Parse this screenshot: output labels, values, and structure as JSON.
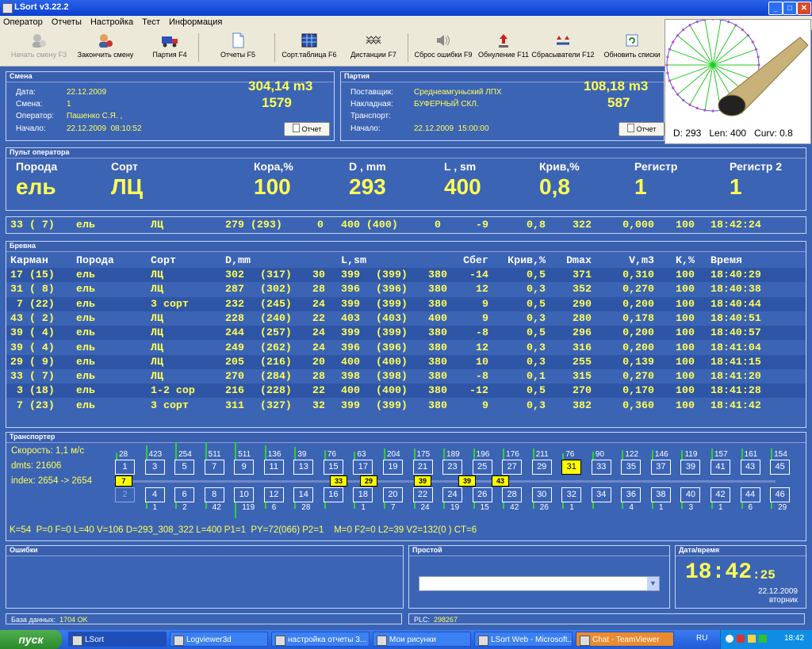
{
  "window": {
    "title": "LSort v3.22.2",
    "btn_min": "_",
    "btn_max": "□",
    "btn_close": "✕"
  },
  "menu": [
    "Оператор",
    "Отчеты",
    "Настройка",
    "Тест",
    "Информация"
  ],
  "toolbar": [
    {
      "label": "Начать смену F3",
      "disabled": true,
      "icon": "start-shift-icon"
    },
    {
      "label": "Закончить смену",
      "disabled": false,
      "icon": "end-shift-icon"
    },
    {
      "label": "Партия F4",
      "disabled": false,
      "icon": "truck-icon"
    },
    {
      "label": "Отчеты F5",
      "disabled": false,
      "icon": "document-icon"
    },
    {
      "label": "Сорт.таблица F6",
      "disabled": false,
      "icon": "table-icon"
    },
    {
      "label": "Дистанции F7",
      "disabled": false,
      "icon": "distance-icon"
    },
    {
      "label": "Сброс ошибки F9",
      "disabled": false,
      "icon": "speaker-icon"
    },
    {
      "label": "Обнуление F11",
      "disabled": false,
      "icon": "reset-arrow-icon"
    },
    {
      "label": "Сбрасыватели F12",
      "disabled": false,
      "icon": "ejector-icon"
    },
    {
      "label": "Обновить списки",
      "disabled": false,
      "icon": "refresh-icon"
    }
  ],
  "view3d": {
    "caption": "D: 293   Len: 400   Curv: 0.8"
  },
  "shift": {
    "title": "Смена",
    "date_label": "Дата:",
    "date": "22.12.2009",
    "shift_label": "Смена:",
    "shift": "1",
    "operator_label": "Оператор:",
    "operator": "Пашенко С.Я. ,",
    "start_label": "Начало:",
    "start": "22.12.2009  08:10:52",
    "volume": "304,14 m3",
    "count": "1579",
    "report_button": "Отчет"
  },
  "batch": {
    "title": "Партия",
    "supplier_label": "Поставщик:",
    "supplier": "Среднеамгуньский ЛПХ",
    "invoice_label": "Накладная:",
    "invoice": "БУФЕРНЫЙ СКЛ.",
    "transport_label": "Транспорт:",
    "transport": "",
    "start_label": "Начало:",
    "start": "22.12.2009  15:00:00",
    "volume": "108,18 m3",
    "count": "587",
    "report_button": "Отчет"
  },
  "operator_panel": {
    "title": "Пульт оператора",
    "fields": [
      {
        "label": "Порода",
        "value": "ель"
      },
      {
        "label": "Сорт",
        "value": "ЛЦ"
      },
      {
        "label": "Кора,%",
        "value": "100"
      },
      {
        "label": "D , mm",
        "value": "293"
      },
      {
        "label": "L , sm",
        "value": "400"
      },
      {
        "label": "Крив,%",
        "value": "0,8"
      },
      {
        "label": "Регистр",
        "value": "1"
      },
      {
        "label": "Регистр 2",
        "value": "1"
      }
    ]
  },
  "current_row": [
    "33 ( 7)",
    "ель",
    "ЛЦ",
    "279 (293)",
    "0",
    "400 (400)",
    "0",
    "-9",
    "0,8",
    "322",
    "0,000",
    "100",
    "18:42:24"
  ],
  "logs": {
    "title": "Бревна",
    "headers": [
      "Карман",
      "Порода",
      "Сорт",
      "D,mm",
      "",
      "",
      "L,sm",
      "",
      "",
      "Сбег",
      "Крив,%",
      "Dmax",
      "V,m3",
      "K,%",
      "Время"
    ],
    "rows": [
      [
        "17 (15)",
        "ель",
        "ЛЦ",
        "302",
        "(317)",
        "30",
        "399",
        "(399)",
        "380",
        "-14",
        "0,5",
        "371",
        "0,310",
        "100",
        "18:40:29"
      ],
      [
        "31 ( 8)",
        "ель",
        "ЛЦ",
        "287",
        "(302)",
        "28",
        "396",
        "(396)",
        "380",
        "12",
        "0,3",
        "352",
        "0,270",
        "100",
        "18:40:38"
      ],
      [
        " 7 (22)",
        "ель",
        "3 сорт",
        "232",
        "(245)",
        "24",
        "399",
        "(399)",
        "380",
        "9",
        "0,5",
        "290",
        "0,200",
        "100",
        "18:40:44"
      ],
      [
        "43 ( 2)",
        "ель",
        "ЛЦ",
        "228",
        "(240)",
        "22",
        "403",
        "(403)",
        "400",
        "9",
        "0,3",
        "280",
        "0,178",
        "100",
        "18:40:51"
      ],
      [
        "39 ( 4)",
        "ель",
        "ЛЦ",
        "244",
        "(257)",
        "24",
        "399",
        "(399)",
        "380",
        "-8",
        "0,5",
        "296",
        "0,200",
        "100",
        "18:40:57"
      ],
      [
        "39 ( 4)",
        "ель",
        "ЛЦ",
        "249",
        "(262)",
        "24",
        "396",
        "(396)",
        "380",
        "12",
        "0,3",
        "316",
        "0,200",
        "100",
        "18:41:04"
      ],
      [
        "29 ( 9)",
        "ель",
        "ЛЦ",
        "205",
        "(216)",
        "20",
        "400",
        "(400)",
        "380",
        "10",
        "0,3",
        "255",
        "0,139",
        "100",
        "18:41:15"
      ],
      [
        "33 ( 7)",
        "ель",
        "ЛЦ",
        "270",
        "(284)",
        "28",
        "398",
        "(398)",
        "380",
        "-8",
        "0,1",
        "315",
        "0,270",
        "100",
        "18:41:20"
      ],
      [
        " 3 (18)",
        "ель",
        "1-2 сор",
        "216",
        "(228)",
        "22",
        "400",
        "(400)",
        "380",
        "-12",
        "0,5",
        "270",
        "0,170",
        "100",
        "18:41:28"
      ],
      [
        " 7 (23)",
        "ель",
        "3 сорт",
        "311",
        "(327)",
        "32",
        "399",
        "(399)",
        "380",
        "9",
        "0,3",
        "382",
        "0,360",
        "100",
        "18:41:42"
      ]
    ]
  },
  "transporter": {
    "title": "Транспортер",
    "speed": "Скорость: 1,1 м/с",
    "dmts": "dmts: 21606",
    "index": "index: 2654 -> 2654",
    "odd_counts": [
      "28",
      "423",
      "254",
      "511",
      "511",
      "136",
      "39",
      "76",
      "63",
      "204",
      "175",
      "189",
      "196",
      "176",
      "211",
      "76",
      "90",
      "122",
      "146",
      "119",
      "157",
      "161",
      "154"
    ],
    "odd_cells": [
      "1",
      "3",
      "5",
      "7",
      "9",
      "11",
      "13",
      "15",
      "17",
      "19",
      "21",
      "23",
      "25",
      "27",
      "29",
      "31",
      "33",
      "35",
      "37",
      "39",
      "41",
      "43",
      "45"
    ],
    "even_cells": [
      "2",
      "4",
      "6",
      "8",
      "10",
      "12",
      "14",
      "16",
      "18",
      "20",
      "22",
      "24",
      "26",
      "28",
      "30",
      "32",
      "34",
      "36",
      "38",
      "40",
      "42",
      "44",
      "46"
    ],
    "even_counts": [
      "",
      "1",
      "2",
      "42",
      "119",
      "6",
      "28",
      "",
      "1",
      "7",
      "24",
      "19",
      "15",
      "42",
      "26",
      "1",
      "",
      "4",
      "1",
      "3",
      "1",
      "6",
      "29"
    ],
    "markers": [
      "7",
      "33",
      "29",
      "39",
      "39",
      "43"
    ],
    "highlight": "31",
    "info": "K=54  P=0 F=0 L=40 V=106 D=293_308_322 L=400 P1=1  PY=72(066) P2=1    M=0 F2=0 L2=39 V2=132(0 ) CT=6"
  },
  "errors": {
    "title": "Ошибки"
  },
  "downtime": {
    "title": "Простой",
    "select_value": ""
  },
  "datetime": {
    "title": "Дата/время",
    "time": "18:42",
    "seconds": ":25",
    "date": "22.12.2009",
    "weekday": "вторник"
  },
  "status": {
    "db_label": "База данных:",
    "db_value": "1704 OK",
    "plc_label": "PLC:",
    "plc_value": "298267"
  },
  "taskbar": {
    "start": "пуск",
    "tasks": [
      "LSort",
      "Logviewer3d",
      "настройка отчеты 3...",
      "Мои рисунки",
      "LSort Web - Microsoft...",
      "Chat - TeamViewer"
    ],
    "lang": "RU",
    "clock": "18:42"
  },
  "colors": {
    "accent_yellow": "#ffff55",
    "panel_blue": "#3c64b5",
    "highlight": "#ffff00"
  }
}
